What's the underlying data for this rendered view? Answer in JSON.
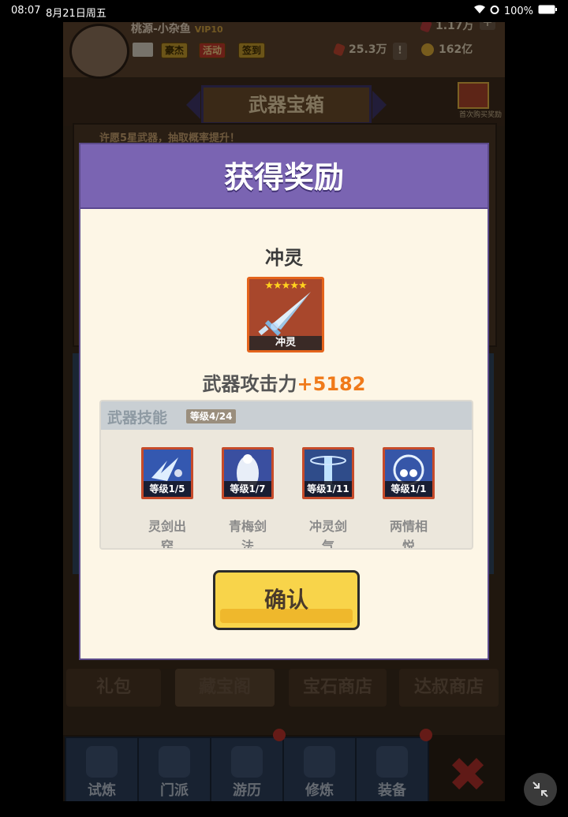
{
  "status": {
    "time": "08:07",
    "date": "8月21日周五",
    "battery": "100%"
  },
  "player": {
    "name": "桃源-小杂鱼",
    "vip": "10",
    "buttons": [
      "豪杰",
      "活动",
      "签到"
    ],
    "gems": "1.17万",
    "power": "25.3万",
    "coins": "162亿"
  },
  "page": {
    "title": "武器宝箱",
    "chest_caption": "首次购买奖励",
    "banner_text": "许愿5星武器，抽取概率提升！"
  },
  "shop_tabs": [
    "礼包",
    "藏宝阁",
    "宝石商店",
    "达叔商店"
  ],
  "bottom_nav": [
    "试炼",
    "门派",
    "游历",
    "修炼",
    "装备"
  ],
  "modal": {
    "title": "获得奖励",
    "item": {
      "name": "冲灵",
      "stars": "★★★★★",
      "caption": "冲灵"
    },
    "attack_label": "武器攻击力",
    "attack_value": "+5182",
    "skills_title": "武器技能",
    "skills_level": "等级4/24",
    "skills": [
      {
        "name": "灵剑出窍",
        "level": "等级1/5"
      },
      {
        "name": "青梅剑法",
        "level": "等级1/7"
      },
      {
        "name": "冲灵剑气",
        "level": "等级1/11"
      },
      {
        "name": "两情相悦",
        "level": "等级1/1"
      }
    ],
    "confirm": "确认"
  },
  "colors": {
    "header": "#7a64b2",
    "accent": "#f07a1a",
    "confirm": "#f8d44a"
  }
}
